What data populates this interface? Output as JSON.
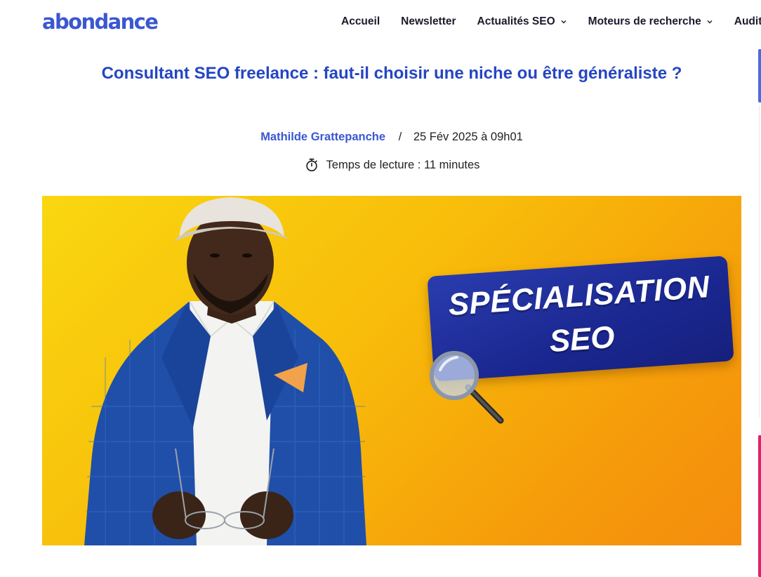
{
  "header": {
    "logo": "abondance",
    "nav": [
      {
        "label": "Accueil",
        "has_dropdown": false
      },
      {
        "label": "Newsletter",
        "has_dropdown": false
      },
      {
        "label": "Actualités SEO",
        "has_dropdown": true
      },
      {
        "label": "Moteurs de recherche",
        "has_dropdown": true
      },
      {
        "label": "Audit",
        "has_dropdown": false
      }
    ]
  },
  "article": {
    "title": "Consultant SEO freelance : faut-il choisir une niche ou être généraliste ?",
    "author": "Mathilde Grattepanche",
    "separator": "/",
    "date": "25 Fév 2025 à 09h01",
    "reading_time": "Temps de lecture : 11 minutes",
    "hero": {
      "badge_line1": "SPÉCIALISATION",
      "badge_line2": "SEO"
    }
  },
  "colors": {
    "brand_blue": "#3b57d1",
    "title_blue": "#2546c2",
    "nav_text": "#1a1a2e",
    "hero_yellow": "#f9d710",
    "hero_orange": "#f58d0e",
    "badge_navy": "#1a2790",
    "accent_pink": "#e0206a"
  },
  "icons": {
    "chevron": "chevron-down-icon",
    "timer": "stopwatch-icon",
    "magnifier": "magnifying-glass-icon"
  }
}
